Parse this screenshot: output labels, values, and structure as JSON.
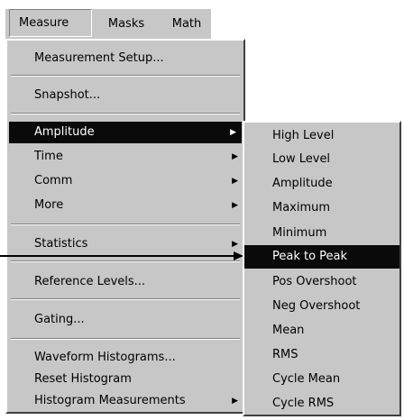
{
  "menubar": {
    "measure": "Measure",
    "masks": "Masks",
    "math": "Math"
  },
  "menu": {
    "measurement_setup": "Measurement Setup...",
    "snapshot": "Snapshot...",
    "amplitude": "Amplitude",
    "time": "Time",
    "comm": "Comm",
    "more": "More",
    "statistics": "Statistics",
    "reference_levels": "Reference Levels...",
    "gating": "Gating...",
    "waveform_histograms": "Waveform Histograms...",
    "reset_histogram": "Reset Histogram",
    "histogram_measurements": "Histogram Measurements"
  },
  "submenu": {
    "items": [
      "High Level",
      "Low Level",
      "Amplitude",
      "Maximum",
      "Minimum",
      "Peak to Peak",
      "Pos Overshoot",
      "Neg Overshoot",
      "Mean",
      "RMS",
      "Cycle Mean",
      "Cycle RMS"
    ]
  },
  "colors": {
    "menu_bg": "#c7c7c7",
    "highlight": "#0a0a0a"
  }
}
